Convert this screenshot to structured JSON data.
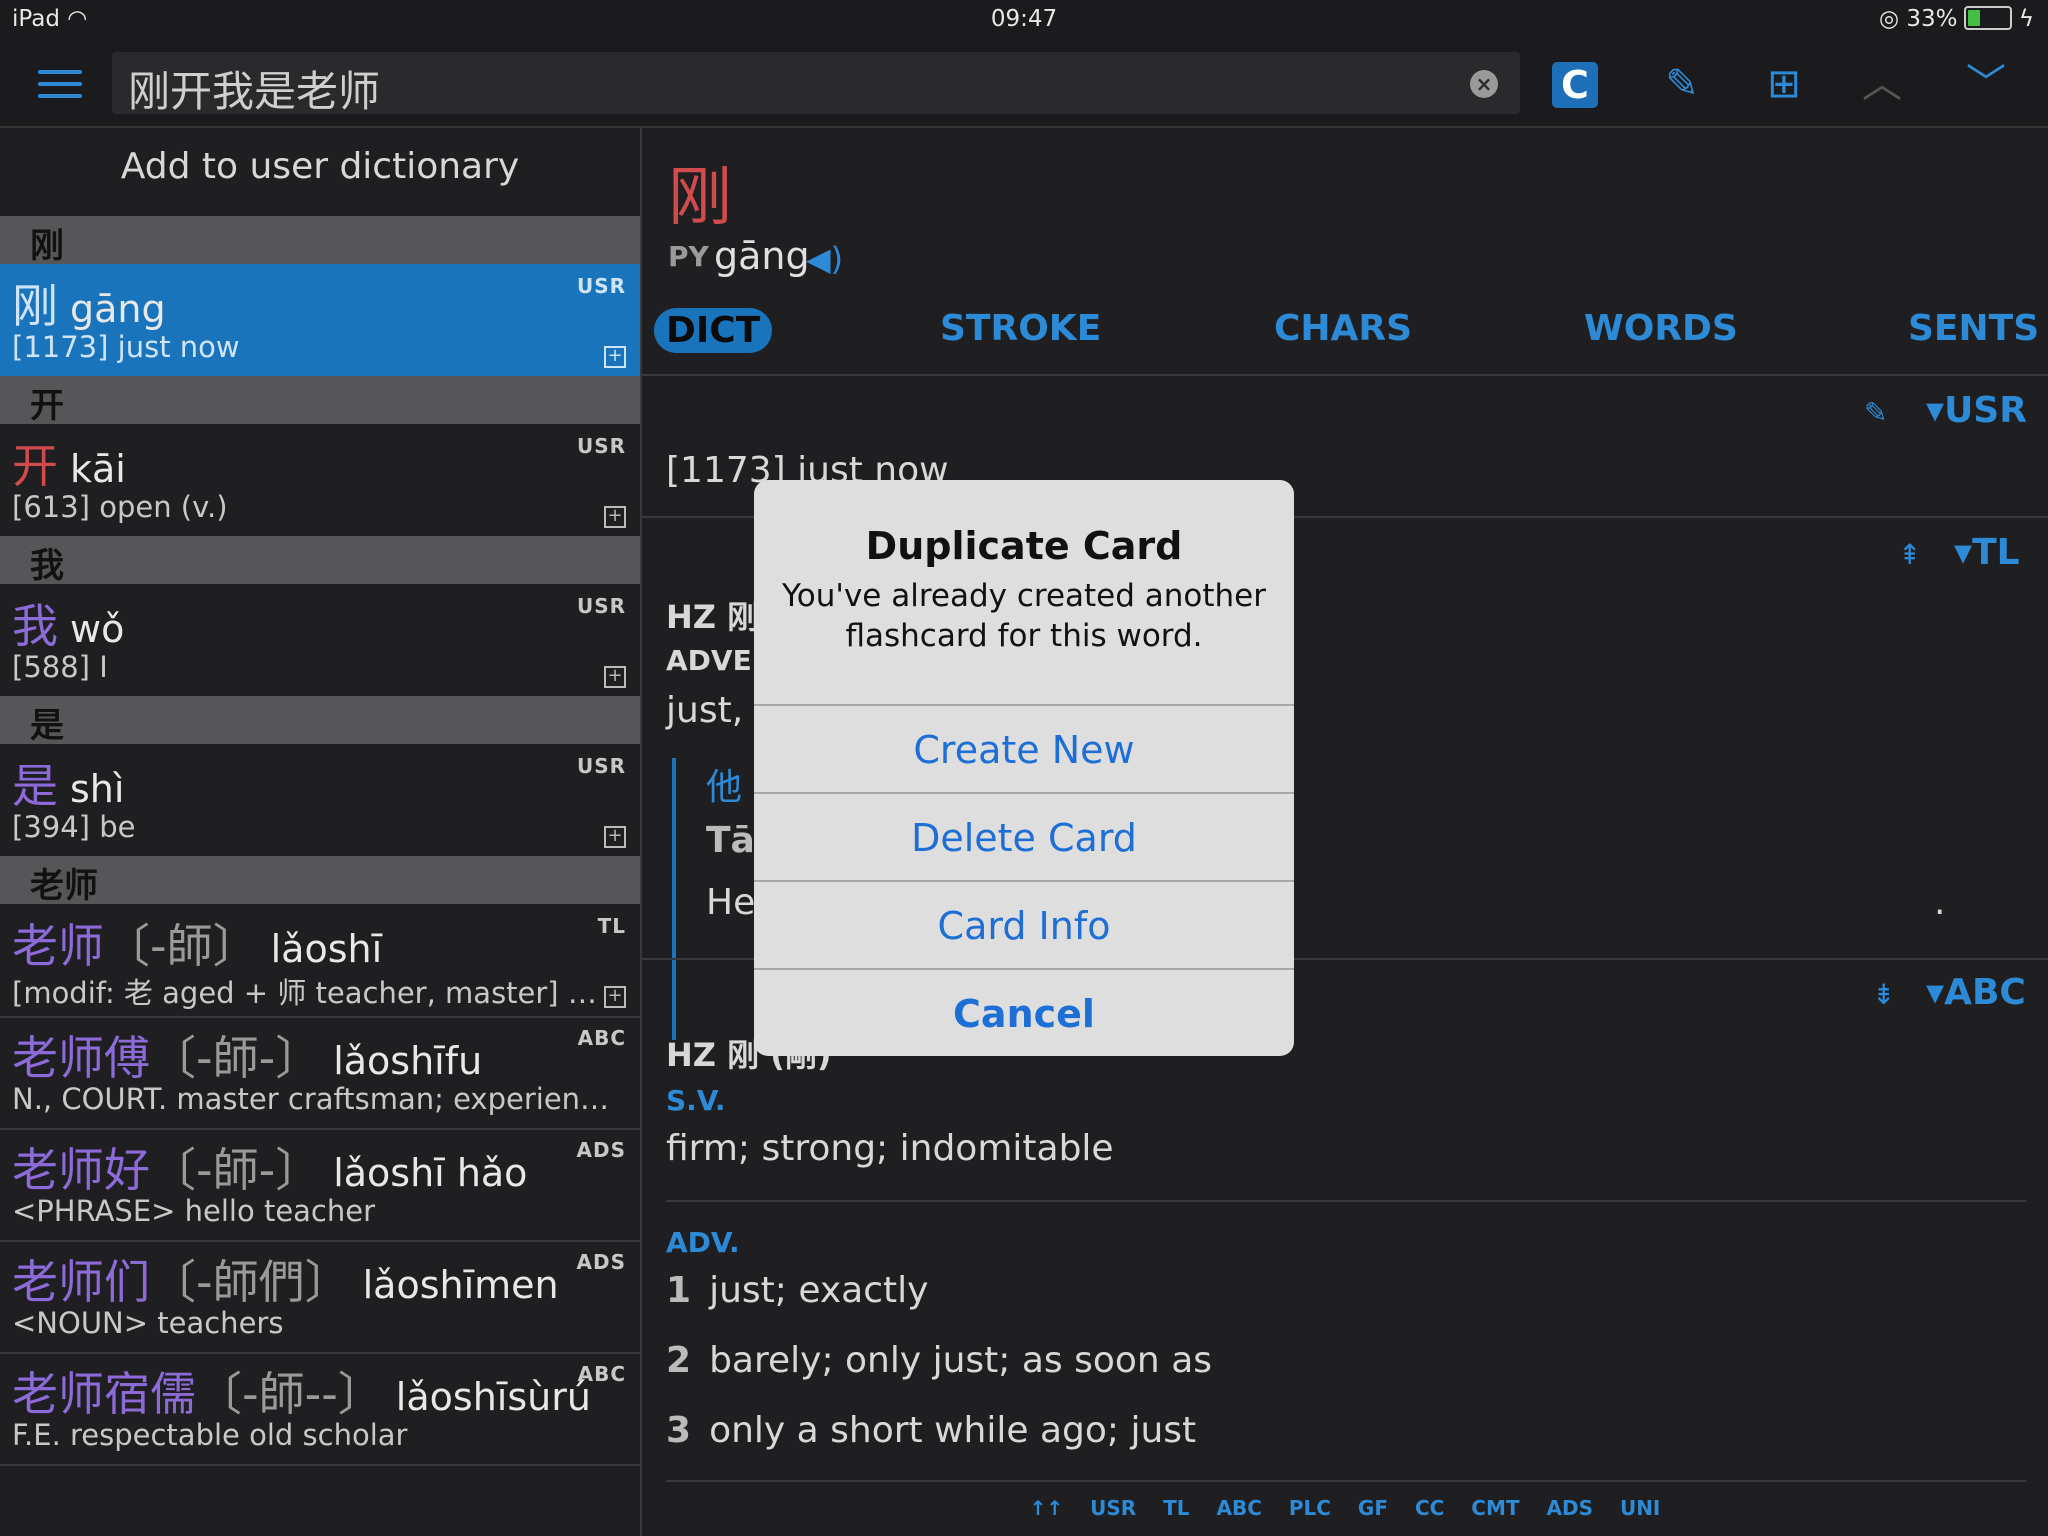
{
  "status": {
    "device": "iPad",
    "time": "09:47",
    "battery": "33%"
  },
  "search": {
    "value": "刚开我是老师"
  },
  "toolbar": {
    "c_label": "C"
  },
  "left": {
    "title": "Add to user dictionary",
    "sections": [
      {
        "head": "刚",
        "hw": "刚",
        "py": "gāng",
        "def": "[1173] just now",
        "src": "USR"
      },
      {
        "head": "开",
        "hw": "开",
        "py": "kāi",
        "def": "[613] open (v.)",
        "src": "USR"
      },
      {
        "head": "我",
        "hw": "我",
        "py": "wǒ",
        "def": "[588] I",
        "src": "USR"
      },
      {
        "head": "是",
        "hw": "是",
        "py": "shì",
        "def": "[394] be",
        "src": "USR"
      }
    ],
    "laoshi_head": "老师",
    "laoshi": [
      {
        "hw1": "老师",
        "trad": "〔-師〕",
        "py": "lǎoshī",
        "def": "[modif: 老 aged + 师 teacher, master] N...",
        "src": "TL"
      },
      {
        "hw1": "老师傅",
        "trad": "〔-師-〕",
        "py": "lǎoshīfu",
        "def": "N., COURT. master craftsman; experience…",
        "src": "ABC"
      },
      {
        "hw1": "老师好",
        "trad": "〔-師-〕",
        "py": "lǎoshī hǎo",
        "def": "<PHRASE> hello teacher",
        "src": "ADS"
      },
      {
        "hw1": "老师们",
        "trad": "〔-師們〕",
        "py": "lǎoshīmen",
        "def": "<NOUN> teachers",
        "src": "ADS"
      },
      {
        "hw1": "老师宿儒",
        "trad": "〔-師--〕",
        "py": "lǎoshīsùrú",
        "def": "F.E. respectable old scholar",
        "src": "ABC"
      }
    ]
  },
  "detail": {
    "char": "刚",
    "py_label": "PY",
    "py": "gāng",
    "tabs": [
      "DICT",
      "STROKE",
      "CHARS",
      "WORDS",
      "SENTS"
    ],
    "usr_tag": "USR",
    "usr_def": "[1173] just now",
    "tl_tag": "TL",
    "tl_hz": "HZ 刚",
    "tl_pos": "ADVE",
    "tl_def": "just, b",
    "tl_ex_hz": "他",
    "tl_ex_py": "Tā",
    "tl_ex_en": "He",
    "tl_ex_end": ".",
    "abc_tag": "ABC",
    "abc_hz": "HZ 刚 (剛)",
    "abc_pos1": "S.V.",
    "abc_def1": "firm; strong; indomitable",
    "abc_pos2": "ADV.",
    "abc_senses": [
      "just; exactly",
      "barely; only just; as soon as",
      "only a short while ago; just"
    ],
    "footer": [
      "↑↑",
      "USR",
      "TL",
      "ABC",
      "PLC",
      "GF",
      "CC",
      "CMT",
      "ADS",
      "UNI"
    ]
  },
  "dialog": {
    "title": "Duplicate Card",
    "message": "You've already created another flashcard for this word.",
    "buttons": [
      "Create New",
      "Delete Card",
      "Card Info",
      "Cancel"
    ]
  }
}
